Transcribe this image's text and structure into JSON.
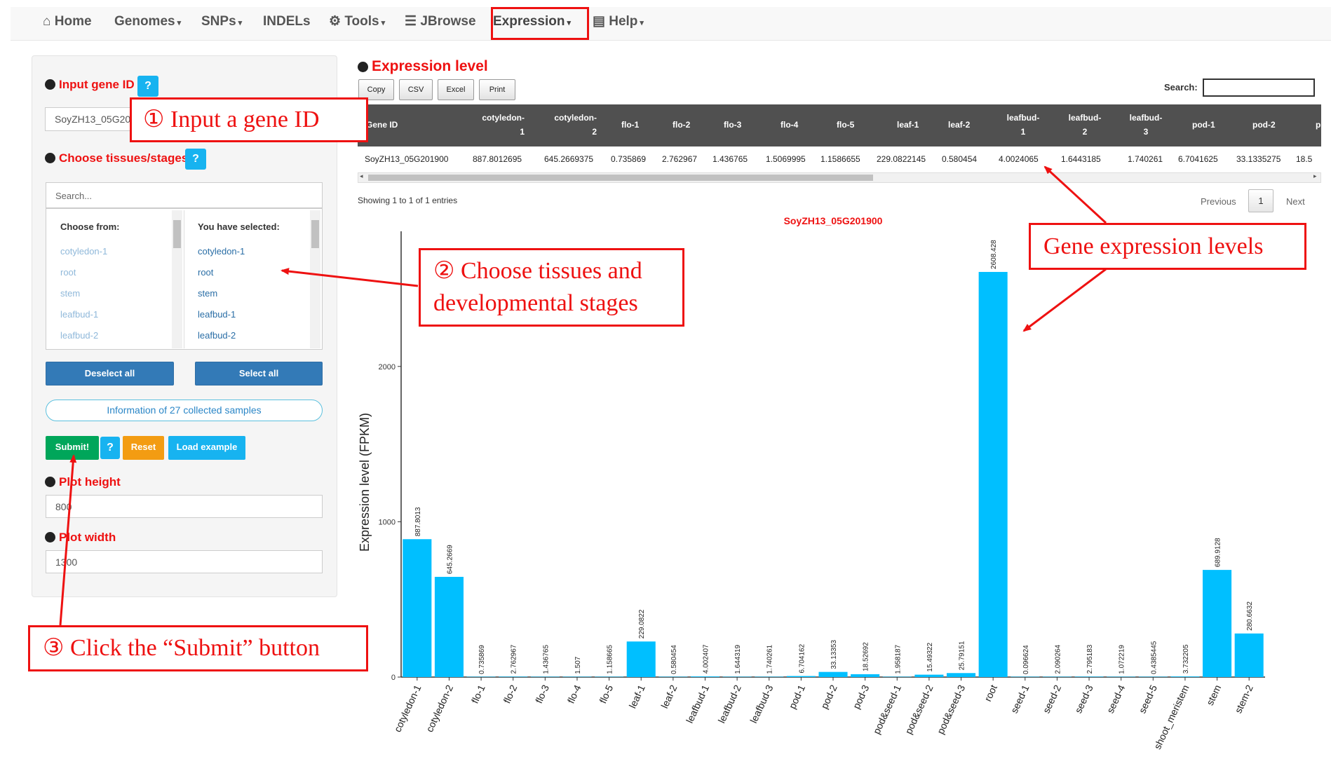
{
  "nav": {
    "home": "Home",
    "genomes": "Genomes",
    "snps": "SNPs",
    "indels": "INDELs",
    "tools": "Tools",
    "jbrowse": "JBrowse",
    "expression": "Expression",
    "help": "Help",
    "caret": "▾"
  },
  "form": {
    "gene_label": "Input gene ID",
    "help_q": "?",
    "gene_value": "SoyZH13_05G201900",
    "tissues_label": "Choose tissues/stages",
    "search_placeholder": "Search...",
    "choose_from": "Choose from:",
    "selected_head": "You have selected:",
    "from_items": [
      "cotyledon-1",
      "root",
      "stem",
      "leafbud-1",
      "leafbud-2"
    ],
    "selected_items": [
      "cotyledon-1",
      "root",
      "stem",
      "leafbud-1",
      "leafbud-2"
    ],
    "deselect_all": "Deselect all",
    "select_all": "Select all",
    "info_samples": "Information of 27 collected samples",
    "submit": "Submit!",
    "reset": "Reset",
    "load_example": "Load example",
    "plot_height_label": "Plot height",
    "plot_height_value": "800",
    "plot_width_label": "Plot width",
    "plot_width_value": "1300"
  },
  "result": {
    "title": "Expression level",
    "buttons": [
      "Copy",
      "CSV",
      "Excel",
      "Print"
    ],
    "search_label": "Search:",
    "headers": [
      "Gene ID",
      "cotyledon-1",
      "cotyledon-2",
      "flo-1",
      "flo-2",
      "flo-3",
      "flo-4",
      "flo-5",
      "leaf-1",
      "leaf-2",
      "leafbud-1",
      "leafbud-2",
      "leafbud-3",
      "pod-1",
      "pod-2",
      "p"
    ],
    "row": [
      "SoyZH13_05G201900",
      "887.8012695",
      "645.2669375",
      "0.735869",
      "2.762967",
      "1.436765",
      "1.5069995",
      "1.1586655",
      "229.0822145",
      "0.580454",
      "4.0024065",
      "1.6443185",
      "1.740261",
      "6.7041625",
      "33.1335275",
      "18.5"
    ],
    "showing": "Showing 1 to 1 of 1 entries",
    "previous": "Previous",
    "page": "1",
    "next": "Next"
  },
  "chart_data": {
    "type": "bar",
    "title": "SoyZH13_05G201900",
    "xlabel": "",
    "ylabel": "Expression level (FPKM)",
    "ylim": [
      0,
      2870
    ],
    "yticks": [
      "0",
      "1000",
      "2000"
    ],
    "bar_color": "#00bfff",
    "categories": [
      "cotyledon-1",
      "cotyledon-2",
      "flo-1",
      "flo-2",
      "flo-3",
      "flo-4",
      "flo-5",
      "leaf-1",
      "leaf-2",
      "leafbud-1",
      "leafbud-2",
      "leafbud-3",
      "pod-1",
      "pod-2",
      "pod-3",
      "pod&seed-1",
      "pod&seed-2",
      "pod&seed-3",
      "root",
      "seed-1",
      "seed-2",
      "seed-3",
      "seed-4",
      "seed-5",
      "shoot_meristem",
      "stem",
      "stem-2"
    ],
    "values": [
      887.8013,
      645.2669,
      0.735869,
      2.762967,
      1.436765,
      1.507,
      1.158665,
      229.0822,
      0.580454,
      4.002407,
      1.644319,
      1.740261,
      6.704162,
      33.13353,
      18.52692,
      1.958187,
      15.49322,
      25.79151,
      2608.428,
      0.096624,
      2.090264,
      2.795183,
      1.072219,
      0.4385445,
      3.732205,
      689.9128,
      280.6632
    ],
    "value_labels": [
      "887.8013",
      "645.2669",
      "0.735869",
      "2.762967",
      "1.436765",
      "1.507",
      "1.158665",
      "229.0822",
      "0.580454",
      "4.002407",
      "1.644319",
      "1.740261",
      "6.704162",
      "33.13353",
      "18.52692",
      "1.958187",
      "15.49322",
      "25.79151",
      "2608.428",
      "0.096624",
      "2.090264",
      "2.795183",
      "1.072219",
      "0.4385445",
      "3.732205",
      "689.9128",
      "280.6632"
    ]
  },
  "annotations": {
    "a1": "① Input a gene ID",
    "a2_line1": "② Choose tissues and",
    "a2_line2": "developmental stages",
    "a3": "③ Click the “Submit” button",
    "a4": "Gene expression levels"
  },
  "colors": {
    "accent_red": "#ee1111",
    "panel_bg": "#f5f5f5",
    "primary_blue": "#337ab7",
    "submit_green": "#00a65a",
    "reset_orange": "#f39c12",
    "help_cyan": "#17b3f0",
    "table_header": "#505050"
  }
}
